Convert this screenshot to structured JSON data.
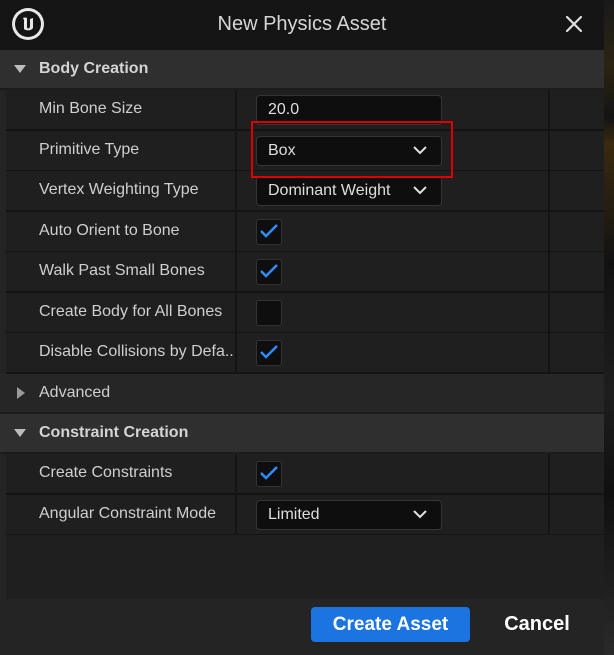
{
  "dialog": {
    "title": "New Physics Asset",
    "logo_icon": "unreal-engine-logo",
    "close_icon": "close-icon"
  },
  "body_creation": {
    "header": "Body Creation",
    "rows": {
      "min_bone_size": {
        "label": "Min Bone Size",
        "value": "20.0"
      },
      "primitive_type": {
        "label": "Primitive Type",
        "value": "Box"
      },
      "vertex_weighting_type": {
        "label": "Vertex Weighting Type",
        "value": "Dominant Weight"
      },
      "auto_orient": {
        "label": "Auto Orient to Bone",
        "checked": true
      },
      "walk_past_small": {
        "label": "Walk Past Small Bones",
        "checked": true
      },
      "create_body_all": {
        "label": "Create Body for All Bones",
        "checked": false
      },
      "disable_collisions": {
        "label": "Disable Collisions by Defa...",
        "checked": true
      }
    }
  },
  "advanced": {
    "label": "Advanced"
  },
  "constraint_creation": {
    "header": "Constraint Creation",
    "rows": {
      "create_constraints": {
        "label": "Create Constraints",
        "checked": true
      },
      "angular_mode": {
        "label": "Angular Constraint Mode",
        "value": "Limited"
      }
    }
  },
  "footer": {
    "create_label": "Create Asset",
    "cancel_label": "Cancel"
  },
  "colors": {
    "accent": "#1b74e0",
    "highlight_box": "#e00000",
    "checkmark": "#2e8dff"
  }
}
